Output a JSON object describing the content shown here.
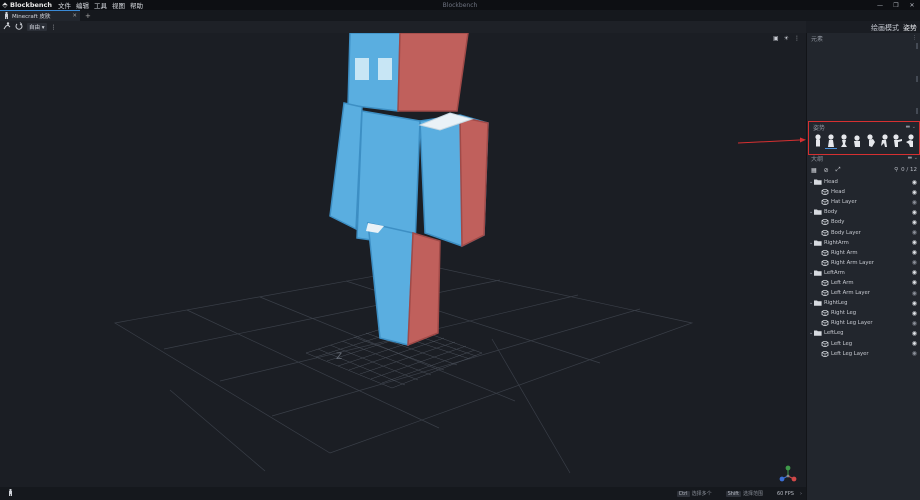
{
  "titlebar": {
    "app_name": "Blockbench",
    "menus": [
      "文件",
      "编辑",
      "工具",
      "视图",
      "帮助"
    ],
    "window_title": "Blockbench",
    "minimize": "—",
    "maximize": "❐",
    "close": "✕"
  },
  "tabs": [
    {
      "label": "Minecraft 皮肤",
      "close": "✕"
    }
  ],
  "new_tab": "+",
  "modes": [
    "绘画模式",
    "姿势"
  ],
  "toolbar": {
    "view_select": "自由 ▾"
  },
  "panels": {
    "elements_title": "元素",
    "pose_title": "姿势",
    "outliner_title": "大纲",
    "outliner_count": "0 / 12"
  },
  "outliner": [
    {
      "type": "group",
      "name": "Head"
    },
    {
      "type": "cube",
      "name": "Head",
      "visible": true
    },
    {
      "type": "cube",
      "name": "Hat Layer",
      "visible": false
    },
    {
      "type": "group",
      "name": "Body"
    },
    {
      "type": "cube",
      "name": "Body",
      "visible": true
    },
    {
      "type": "cube",
      "name": "Body Layer",
      "visible": false
    },
    {
      "type": "group",
      "name": "RightArm"
    },
    {
      "type": "cube",
      "name": "Right Arm",
      "visible": true
    },
    {
      "type": "cube",
      "name": "Right Arm Layer",
      "visible": false
    },
    {
      "type": "group",
      "name": "LeftArm"
    },
    {
      "type": "cube",
      "name": "Left Arm",
      "visible": true
    },
    {
      "type": "cube",
      "name": "Left Arm Layer",
      "visible": false
    },
    {
      "type": "group",
      "name": "RightLeg"
    },
    {
      "type": "cube",
      "name": "Right Leg",
      "visible": true
    },
    {
      "type": "cube",
      "name": "Right Leg Layer",
      "visible": false
    },
    {
      "type": "group",
      "name": "LeftLeg"
    },
    {
      "type": "cube",
      "name": "Left Leg",
      "visible": true
    },
    {
      "type": "cube",
      "name": "Left Leg Layer",
      "visible": false
    }
  ],
  "statusbar": {
    "key1": "Ctrl",
    "hint1": "选择多个",
    "key2": "Shift",
    "hint2": "选择范围",
    "fps": "60 FPS"
  },
  "viewport": {
    "axis_label": "Z"
  },
  "colors": {
    "accent": "#3a8ad6",
    "highlight_box": "#d63031",
    "skin_blue": "#5aaee0",
    "skin_red": "#c0605c"
  }
}
